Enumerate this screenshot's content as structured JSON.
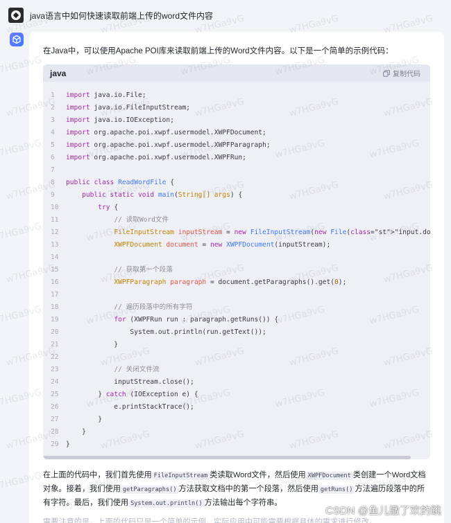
{
  "question": "java语言中如何快速读取前端上传的word文件内容",
  "answer": {
    "intro": "在Java中，可以使用Apache POI库来读取前端上传的Word文件内容。以下是一个简单的示例代码：",
    "code": {
      "language": "java",
      "copy_label": "复制代码",
      "lines": [
        "import java.io.File;",
        "import java.io.FileInputStream;",
        "import java.io.IOException;",
        "import org.apache.poi.xwpf.usermodel.XWPFDocument;",
        "import org.apache.poi.xwpf.usermodel.XWPFParagraph;",
        "import org.apache.poi.xwpf.usermodel.XWPFRun;",
        "",
        "public class ReadWordFile {",
        "    public static void main(String[] args) {",
        "        try {",
        "            // 读取Word文件",
        "            FileInputStream inputStream = new FileInputStream(new File(\"input.docx\"));",
        "            XWPFDocument document = new XWPFDocument(inputStream);",
        "",
        "            // 获取第一个段落",
        "            XWPFParagraph paragraph = document.getParagraphs().get(0);",
        "",
        "            // 遍历段落中的所有字符",
        "            for (XWPFRun run : paragraph.getRuns()) {",
        "                System.out.println(run.getText());",
        "            }",
        "",
        "            // 关闭文件流",
        "            inputStream.close();",
        "        } catch (IOException e) {",
        "            e.printStackTrace();",
        "        }",
        "    }",
        "}"
      ]
    },
    "explanation": {
      "t1": "在上面的代码中，我们首先使用",
      "c1": "FileInputStream",
      "t2": "类读取Word文件，然后使用",
      "c2": "XWPFDocument",
      "t3": "类创建一个Word文档对象。接着，我们使用",
      "c3": "getParagraphs()",
      "t4": "方法获取文档中的第一个段落，然后使用",
      "c4": "getRuns()",
      "t5": "方法遍历段落中的所有字符。最后，我们使用",
      "c5": "System.out.println()",
      "t6": "方法输出每个字符串。"
    },
    "faded_line": "需要注意的是，上面的代码只是一个简单的示例，实际应用中可能需要根据具体的需求进行修改。"
  },
  "watermark_text": "w7HGa9vG",
  "csdn_mark": "CSDN @鱼儿撒了欢的跳",
  "colors": {
    "page_bg": "#f3f4f8",
    "card_bg": "#ffffff",
    "code_bg": "#eef0f6",
    "keyword": "#a626a4",
    "type": "#c18401",
    "string": "#50a14f",
    "comment": "#8c8f99",
    "accent": "#3d7bfd"
  }
}
